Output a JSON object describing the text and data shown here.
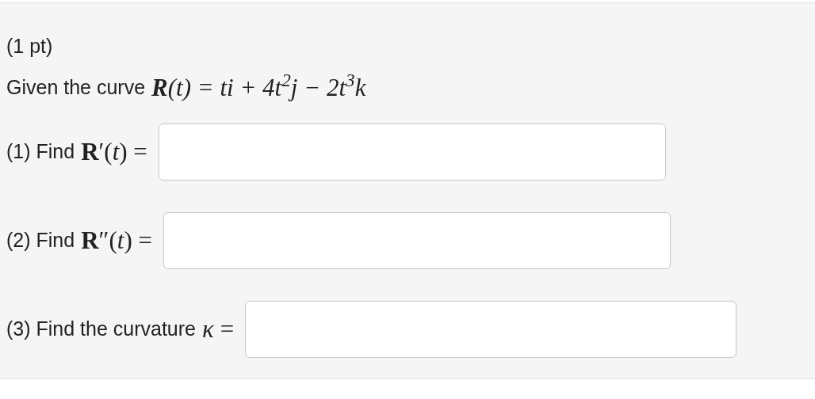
{
  "points": "(1 pt)",
  "intro": {
    "text": "Given the curve",
    "formula": "**R**(t) = ti + 4t$^{2}$j − 2t$^{3}$k"
  },
  "questions": [
    {
      "label": "(1) Find",
      "formula": "**R**′(*t*) ="
    },
    {
      "label": "(2) Find",
      "formula": "**R**″(*t*) ="
    },
    {
      "label": "(3) Find the curvature",
      "formula": "*κ* ="
    }
  ]
}
